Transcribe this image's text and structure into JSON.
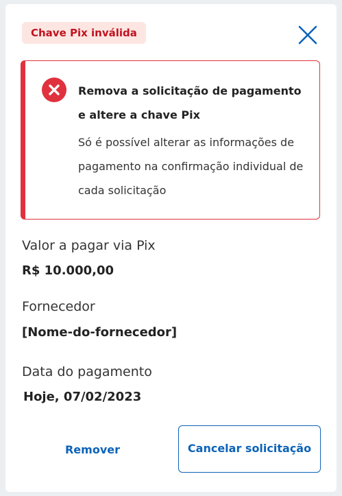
{
  "header": {
    "badge_label": "Chave Pix inválida",
    "close_icon": "close-icon"
  },
  "alert": {
    "icon": "error-x-icon",
    "title": "Remova a solicitação de pagamento e altere a chave Pix",
    "message": "Só é possível alterar as informações de pagamento na confirmação individual de cada solicitação"
  },
  "fields": [
    {
      "label": "Valor a pagar via Pix",
      "value": "R$ 10.000,00"
    },
    {
      "label": "Fornecedor",
      "value": "[Nome-do-fornecedor]"
    },
    {
      "label": "Data do pagamento",
      "value": "Hoje, 07/02/2023"
    }
  ],
  "actions": {
    "remove_label": "Remover",
    "cancel_label": "Cancelar solicitação"
  },
  "colors": {
    "danger": "#e0323e",
    "badge_bg": "#fde6e2",
    "badge_text": "#c1121f",
    "primary": "#0c63b8"
  }
}
